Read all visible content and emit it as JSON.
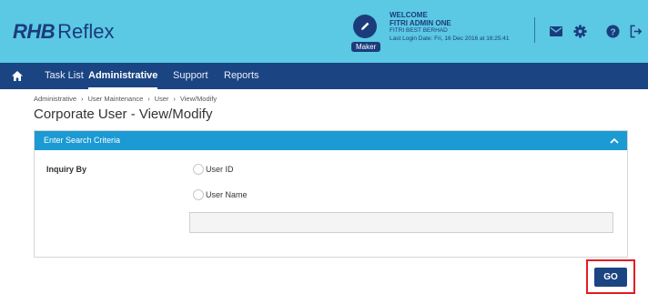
{
  "brand": {
    "logo_part1": "RHB",
    "logo_part2": "Reflex"
  },
  "user": {
    "role": "Maker",
    "welcome": "WELCOME",
    "name": "FITRI ADMIN ONE",
    "company": "FITRI BEST BERHAD",
    "last_login": "Last Login Date: Fri, 16 Dec 2016 at 16:25:41"
  },
  "header_icons": [
    "mail-icon",
    "gear-icon",
    "help-icon",
    "logout-icon"
  ],
  "nav": {
    "items": [
      {
        "label": "Task List",
        "active": false
      },
      {
        "label": "Administrative",
        "active": true
      },
      {
        "label": "Support",
        "active": false
      },
      {
        "label": "Reports",
        "active": false
      }
    ]
  },
  "breadcrumb": [
    "Administrative",
    "User Maintenance",
    "User",
    "View/Modify"
  ],
  "page_title": "Corporate User - View/Modify",
  "panel": {
    "title": "Enter Search Criteria",
    "inquiry_label": "Inquiry By",
    "options": [
      "User ID",
      "User Name"
    ],
    "search_value": ""
  },
  "go_label": "GO",
  "colors": {
    "header_bg": "#5bc8e4",
    "brand_navy": "#1b3c7b",
    "nav_bg": "#1b4482",
    "panel_header": "#1b9ad3",
    "highlight": "#e21d23"
  }
}
